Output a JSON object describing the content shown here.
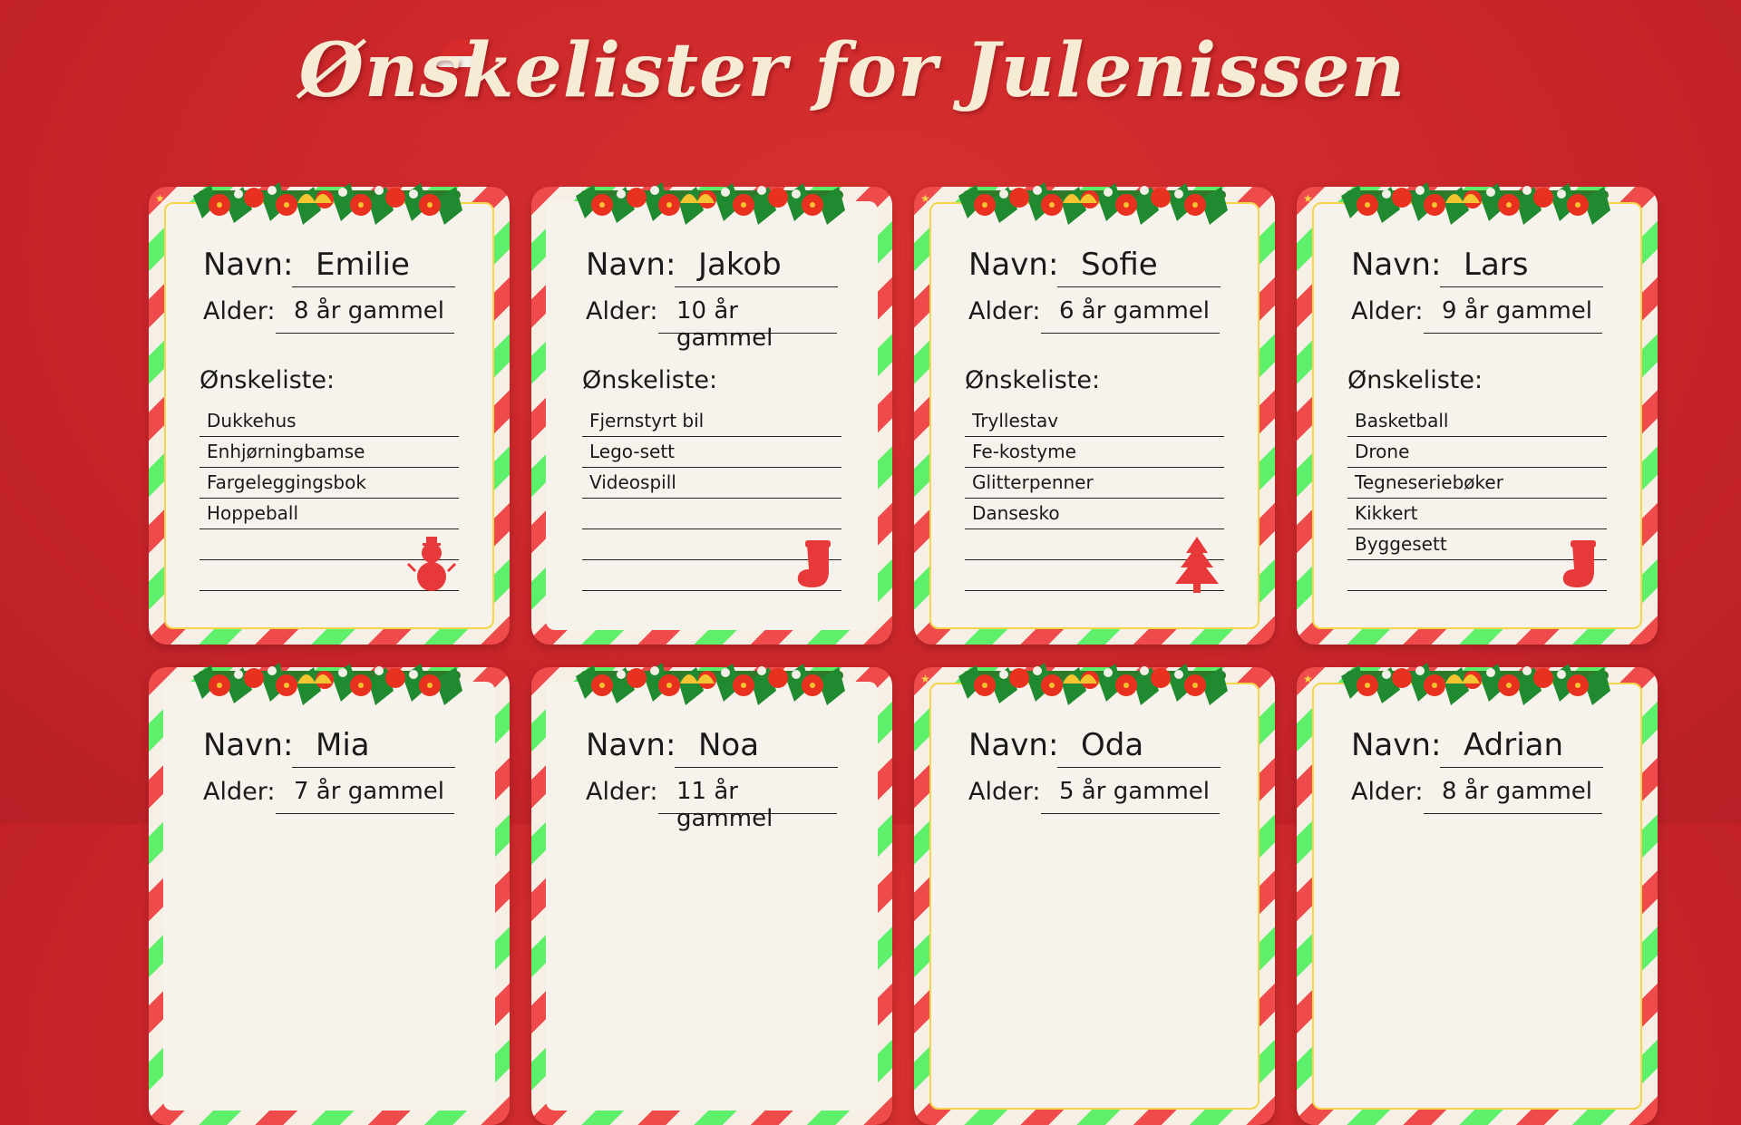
{
  "page": {
    "title": "Ønskelister for Julenissen"
  },
  "labels": {
    "name": "Navn:",
    "age": "Alder:",
    "wishlist": "Ønskeliste:"
  },
  "colors": {
    "background": "#c8252a",
    "stripe_red": "#f04b4b",
    "stripe_green": "#5ef06a",
    "paper": "#f7f3ec",
    "gold": "#f3d64a",
    "title": "#f6ecd6"
  },
  "cards": [
    {
      "name": "Emilie",
      "age": "8 år gammel",
      "wishes": [
        "Dukkehus",
        " Enhjørningbamse",
        "  Fargeleggingsbok",
        " Hoppeball",
        "",
        ""
      ],
      "decoration": "snowman-icon"
    },
    {
      "name": "Jakob",
      "age": "10 år gammel",
      "wishes": [
        "Fjernstyrt bil",
        "  Lego-sett",
        "  Videospill",
        "",
        "",
        ""
      ],
      "decoration": "stocking-icon"
    },
    {
      "name": "Sofie",
      "age": "6 år gammel",
      "wishes": [
        "Tryllestav",
        " Fe-kostyme",
        "  Glitterpenner",
        "  Dansesko",
        "",
        ""
      ],
      "decoration": "christmas-tree-icon"
    },
    {
      "name": "Lars",
      "age": "9 år gammel",
      "wishes": [
        "Basketball",
        "Drone",
        "  Tegneseriebøker",
        "Kikkert",
        "Byggesett",
        ""
      ],
      "decoration": "stocking-icon"
    },
    {
      "name": "Mia",
      "age": "7 år gammel",
      "wishes": [],
      "decoration": ""
    },
    {
      "name": "Noa",
      "age": "11 år gammel",
      "wishes": [],
      "decoration": ""
    },
    {
      "name": "Oda",
      "age": "5 år gammel",
      "wishes": [],
      "decoration": ""
    },
    {
      "name": "Adrian",
      "age": "8 år gammel",
      "wishes": [],
      "decoration": ""
    }
  ]
}
